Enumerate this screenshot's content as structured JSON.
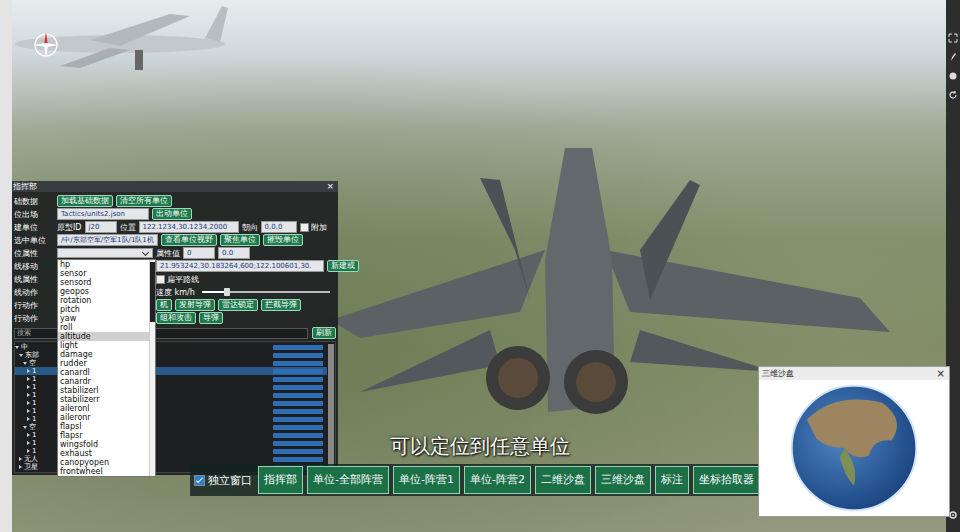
{
  "window": {
    "title": "指挥部",
    "close": "×"
  },
  "rows": [
    {
      "label": "础数据",
      "parts": [
        {
          "kind": "button",
          "text": "加载基础数据"
        },
        {
          "kind": "button",
          "text": "清空所有单位"
        }
      ]
    },
    {
      "label": "位出场",
      "parts": [
        {
          "kind": "input",
          "text": "Tactics/units2.json"
        },
        {
          "kind": "button",
          "text": "出动单位"
        }
      ]
    },
    {
      "label": "建单位",
      "parts": [
        {
          "kind": "text",
          "text": "原型ID"
        },
        {
          "kind": "input",
          "text": "j20"
        },
        {
          "kind": "text",
          "text": "位置"
        },
        {
          "kind": "input",
          "text": "122.1234,30.1234,2000"
        },
        {
          "kind": "text",
          "text": "朝向"
        },
        {
          "kind": "input",
          "text": "0,0,0"
        },
        {
          "kind": "checkbox",
          "text": "附加",
          "checked": false
        }
      ]
    },
    {
      "label": "选中单位",
      "parts": [
        {
          "kind": "input",
          "text": "/中/东部空军/空军1队/1队1机"
        },
        {
          "kind": "button",
          "text": "查看单位视野"
        },
        {
          "kind": "button",
          "text": "聚焦单位"
        },
        {
          "kind": "button",
          "text": "摧毁单位"
        }
      ]
    },
    {
      "label": "位属性",
      "parts": [
        {
          "kind": "select",
          "open": true,
          "options": [
            {
              "text": "hp",
              "selected": false
            },
            {
              "text": "sensor",
              "selected": false
            },
            {
              "text": "sensord",
              "selected": false
            },
            {
              "text": "geopos",
              "selected": false
            },
            {
              "text": "rotation",
              "selected": false
            },
            {
              "text": "pitch",
              "selected": false
            },
            {
              "text": "yaw",
              "selected": false
            },
            {
              "text": "roll",
              "selected": false
            },
            {
              "text": "altitude",
              "selected": true
            },
            {
              "text": "light",
              "selected": false
            },
            {
              "text": "damage",
              "selected": false
            },
            {
              "text": "rudder",
              "selected": false
            },
            {
              "text": "canardl",
              "selected": false
            },
            {
              "text": "canardr",
              "selected": false
            },
            {
              "text": "stabilizerl",
              "selected": false
            },
            {
              "text": "stabilizerr",
              "selected": false
            },
            {
              "text": "aileronl",
              "selected": false
            },
            {
              "text": "aileronr",
              "selected": false
            },
            {
              "text": "flapsl",
              "selected": false
            },
            {
              "text": "flapsr",
              "selected": false
            },
            {
              "text": "wingsfold",
              "selected": false
            },
            {
              "text": "exhaust",
              "selected": false
            },
            {
              "text": "canopyopen",
              "selected": false
            },
            {
              "text": "frontwheel",
              "selected": false
            }
          ]
        },
        {
          "kind": "text",
          "text": "属性值"
        },
        {
          "kind": "input",
          "text": "0"
        },
        {
          "kind": "input",
          "text": "0.0"
        }
      ]
    },
    {
      "label": "线移动",
      "parts": [
        {
          "kind": "covered"
        },
        {
          "kind": "input",
          "text": "21.953242,30.183264,600;122.100601,30."
        },
        {
          "kind": "button",
          "text": "新建或"
        }
      ]
    },
    {
      "label": "线属性",
      "parts": [
        {
          "kind": "covered"
        },
        {
          "kind": "checkbox",
          "text": "扁平路线",
          "checked": false
        }
      ]
    },
    {
      "label": "线动作",
      "parts": [
        {
          "kind": "covered"
        },
        {
          "kind": "text",
          "text": "速度 km/h"
        },
        {
          "kind": "slider",
          "level": 0.2
        }
      ]
    },
    {
      "label": "行动作",
      "parts": [
        {
          "kind": "covered"
        },
        {
          "kind": "button",
          "text": "机"
        },
        {
          "kind": "button",
          "text": "发射导弹"
        },
        {
          "kind": "button",
          "text": "雷达锁定"
        },
        {
          "kind": "button",
          "text": "拦截导弹"
        }
      ]
    },
    {
      "label": "行动作",
      "parts": [
        {
          "kind": "covered"
        },
        {
          "kind": "button",
          "text": "组和攻击"
        },
        {
          "kind": "button",
          "text": "导弹"
        }
      ]
    }
  ],
  "tree": {
    "search_placeholder": "搜索",
    "refresh": "刷新",
    "rows": [
      {
        "label": "中",
        "depth": 0,
        "expanded": true,
        "selected": false,
        "level": 1
      },
      {
        "label": "东部",
        "depth": 1,
        "expanded": true,
        "selected": false,
        "level": 1
      },
      {
        "label": "空",
        "depth": 2,
        "expanded": true,
        "selected": false,
        "level": 1
      },
      {
        "label": "1",
        "depth": 3,
        "expanded": false,
        "selected": true,
        "level": 1
      },
      {
        "label": "1",
        "depth": 3,
        "expanded": false,
        "selected": false,
        "level": 1
      },
      {
        "label": "1",
        "depth": 3,
        "expanded": false,
        "selected": false,
        "level": 1
      },
      {
        "label": "1",
        "depth": 3,
        "expanded": false,
        "selected": false,
        "level": 1
      },
      {
        "label": "1",
        "depth": 3,
        "expanded": false,
        "selected": false,
        "level": 1
      },
      {
        "label": "1",
        "depth": 3,
        "expanded": false,
        "selected": false,
        "level": 1
      },
      {
        "label": "1",
        "depth": 3,
        "expanded": false,
        "selected": false,
        "level": 1
      },
      {
        "label": "空",
        "depth": 2,
        "expanded": true,
        "selected": false,
        "level": 1
      },
      {
        "label": "1",
        "depth": 3,
        "expanded": false,
        "selected": false,
        "level": 1
      },
      {
        "label": "1",
        "depth": 3,
        "expanded": false,
        "selected": false,
        "level": 1
      },
      {
        "label": "1",
        "depth": 3,
        "expanded": false,
        "selected": false,
        "level": 1
      },
      {
        "label": "无人",
        "depth": 1,
        "expanded": false,
        "selected": false,
        "level": 1
      },
      {
        "label": "卫星",
        "depth": 1,
        "expanded": false,
        "selected": false,
        "level": 1
      }
    ]
  },
  "toolbar": {
    "independent_window": {
      "text": "独立窗口",
      "checked": true
    },
    "buttons": [
      {
        "text": "指挥部"
      },
      {
        "text": "单位-全部阵营"
      },
      {
        "text": "单位-阵营1"
      },
      {
        "text": "单位-阵营2"
      },
      {
        "text": "二维沙盘"
      },
      {
        "text": "三维沙盘"
      },
      {
        "text": "标注"
      },
      {
        "text": "坐标拾取器"
      }
    ],
    "close": "x"
  },
  "minimap": {
    "title": "三维沙盘",
    "close": "×"
  },
  "subtitle": "可以定位到任意单位"
}
